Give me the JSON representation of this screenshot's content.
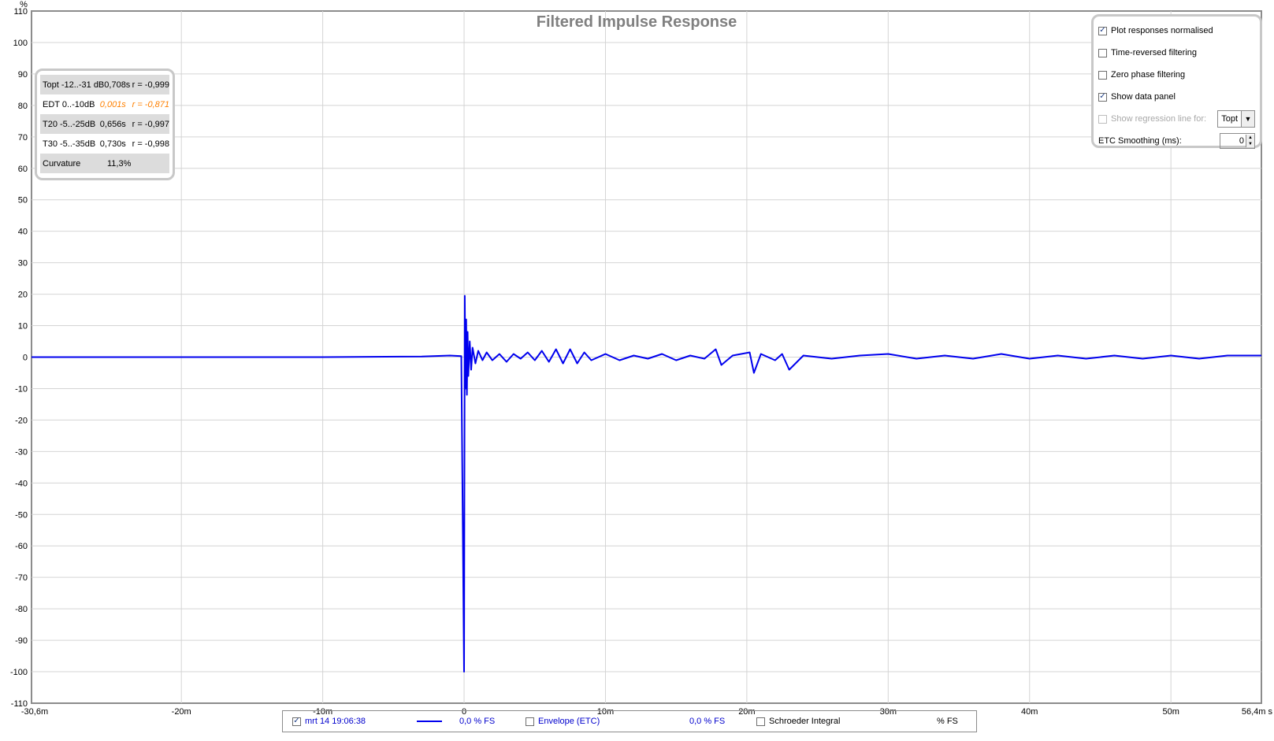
{
  "colors": {
    "trace": "#0000ee",
    "grid": "#d4d4d4",
    "axis": "#8c8c8c",
    "title": "#808080",
    "orange": "#ff8000"
  },
  "chart_data": {
    "type": "line",
    "title": "Filtered Impulse Response",
    "ylabel": "%",
    "xunit": "s",
    "xlim": [
      -0.0306,
      0.0564
    ],
    "ylim": [
      -110,
      110
    ],
    "grid": true,
    "x_tick_labels": [
      "-30,6m",
      "-20m",
      "-10m",
      "0",
      "10m",
      "20m",
      "30m",
      "40m",
      "50m",
      "56,4m s"
    ],
    "x_tick_values": [
      -0.0306,
      -0.02,
      -0.01,
      0,
      0.01,
      0.02,
      0.03,
      0.04,
      0.05,
      0.0564
    ],
    "y_tick_values": [
      110,
      100,
      90,
      80,
      70,
      60,
      50,
      40,
      30,
      20,
      10,
      0,
      -10,
      -20,
      -30,
      -40,
      -50,
      -60,
      -70,
      -80,
      -90,
      -100,
      -110
    ],
    "series": [
      {
        "name": "mrt 14 19:06:38",
        "x": [
          -0.0306,
          -0.02,
          -0.01,
          -0.003,
          -0.001,
          -0.0002,
          0.0,
          5e-05,
          0.0001,
          0.00015,
          0.0002,
          0.00025,
          0.0003,
          0.0004,
          0.0005,
          0.0006,
          0.0008,
          0.001,
          0.0013,
          0.0016,
          0.002,
          0.0025,
          0.003,
          0.0035,
          0.004,
          0.0045,
          0.005,
          0.0055,
          0.006,
          0.0065,
          0.007,
          0.0075,
          0.008,
          0.0085,
          0.009,
          0.01,
          0.011,
          0.012,
          0.013,
          0.014,
          0.015,
          0.016,
          0.017,
          0.0178,
          0.0182,
          0.019,
          0.0202,
          0.0205,
          0.021,
          0.022,
          0.0225,
          0.023,
          0.024,
          0.026,
          0.028,
          0.03,
          0.032,
          0.034,
          0.036,
          0.038,
          0.04,
          0.042,
          0.044,
          0.046,
          0.048,
          0.05,
          0.052,
          0.054,
          0.0564
        ],
        "values": [
          0,
          0,
          0,
          0.2,
          0.5,
          0.3,
          -100,
          19.5,
          -10,
          12,
          -12,
          8,
          -6,
          5,
          -4,
          3,
          -2,
          2,
          -1,
          1.5,
          -1,
          1,
          -1.5,
          1,
          -0.5,
          1.5,
          -1,
          2,
          -1.5,
          2.5,
          -2,
          2.5,
          -2,
          1.5,
          -1,
          1,
          -1,
          0.5,
          -0.5,
          1,
          -1,
          0.5,
          -0.5,
          2.5,
          -2.5,
          0.5,
          1.5,
          -5,
          1,
          -1,
          1,
          -4,
          0.5,
          -0.5,
          0.5,
          1,
          -0.5,
          0.5,
          -0.5,
          1,
          -0.5,
          0.5,
          -0.5,
          0.5,
          -0.5,
          0.5,
          -0.5,
          0.5,
          0.5
        ]
      }
    ]
  },
  "data_panel": {
    "rows": [
      {
        "label": "Topt -12..-31 dB",
        "value": "0,708s",
        "r": "r = -0,999"
      },
      {
        "label": "EDT  0..-10dB",
        "value": "0,001s",
        "r": "r = -0,871"
      },
      {
        "label": "T20 -5..-25dB",
        "value": "0,656s",
        "r": "r = -0,997"
      },
      {
        "label": "T30 -5..-35dB",
        "value": "0,730s",
        "r": "r = -0,998"
      },
      {
        "label": "Curvature",
        "value": "11,3%",
        "r": ""
      }
    ]
  },
  "controls": {
    "plot_normalised": {
      "label": "Plot responses normalised",
      "checked": true
    },
    "time_reversed": {
      "label": "Time-reversed filtering",
      "checked": false
    },
    "zero_phase": {
      "label": "Zero phase filtering",
      "checked": false
    },
    "show_data_panel": {
      "label": "Show data panel",
      "checked": true
    },
    "regression": {
      "label": "Show regression line for:",
      "checked": false,
      "value": "Topt"
    },
    "etc_smoothing": {
      "label": "ETC Smoothing (ms):",
      "value": "0"
    }
  },
  "legend": {
    "measurement": {
      "label": "mrt 14 19:06:38",
      "checked": true,
      "value": "0,0 % FS"
    },
    "envelope": {
      "label": "Envelope (ETC)",
      "checked": false,
      "value": "0,0 % FS"
    },
    "schroeder": {
      "label": "Schroeder Integral",
      "checked": false,
      "value": "% FS"
    }
  }
}
